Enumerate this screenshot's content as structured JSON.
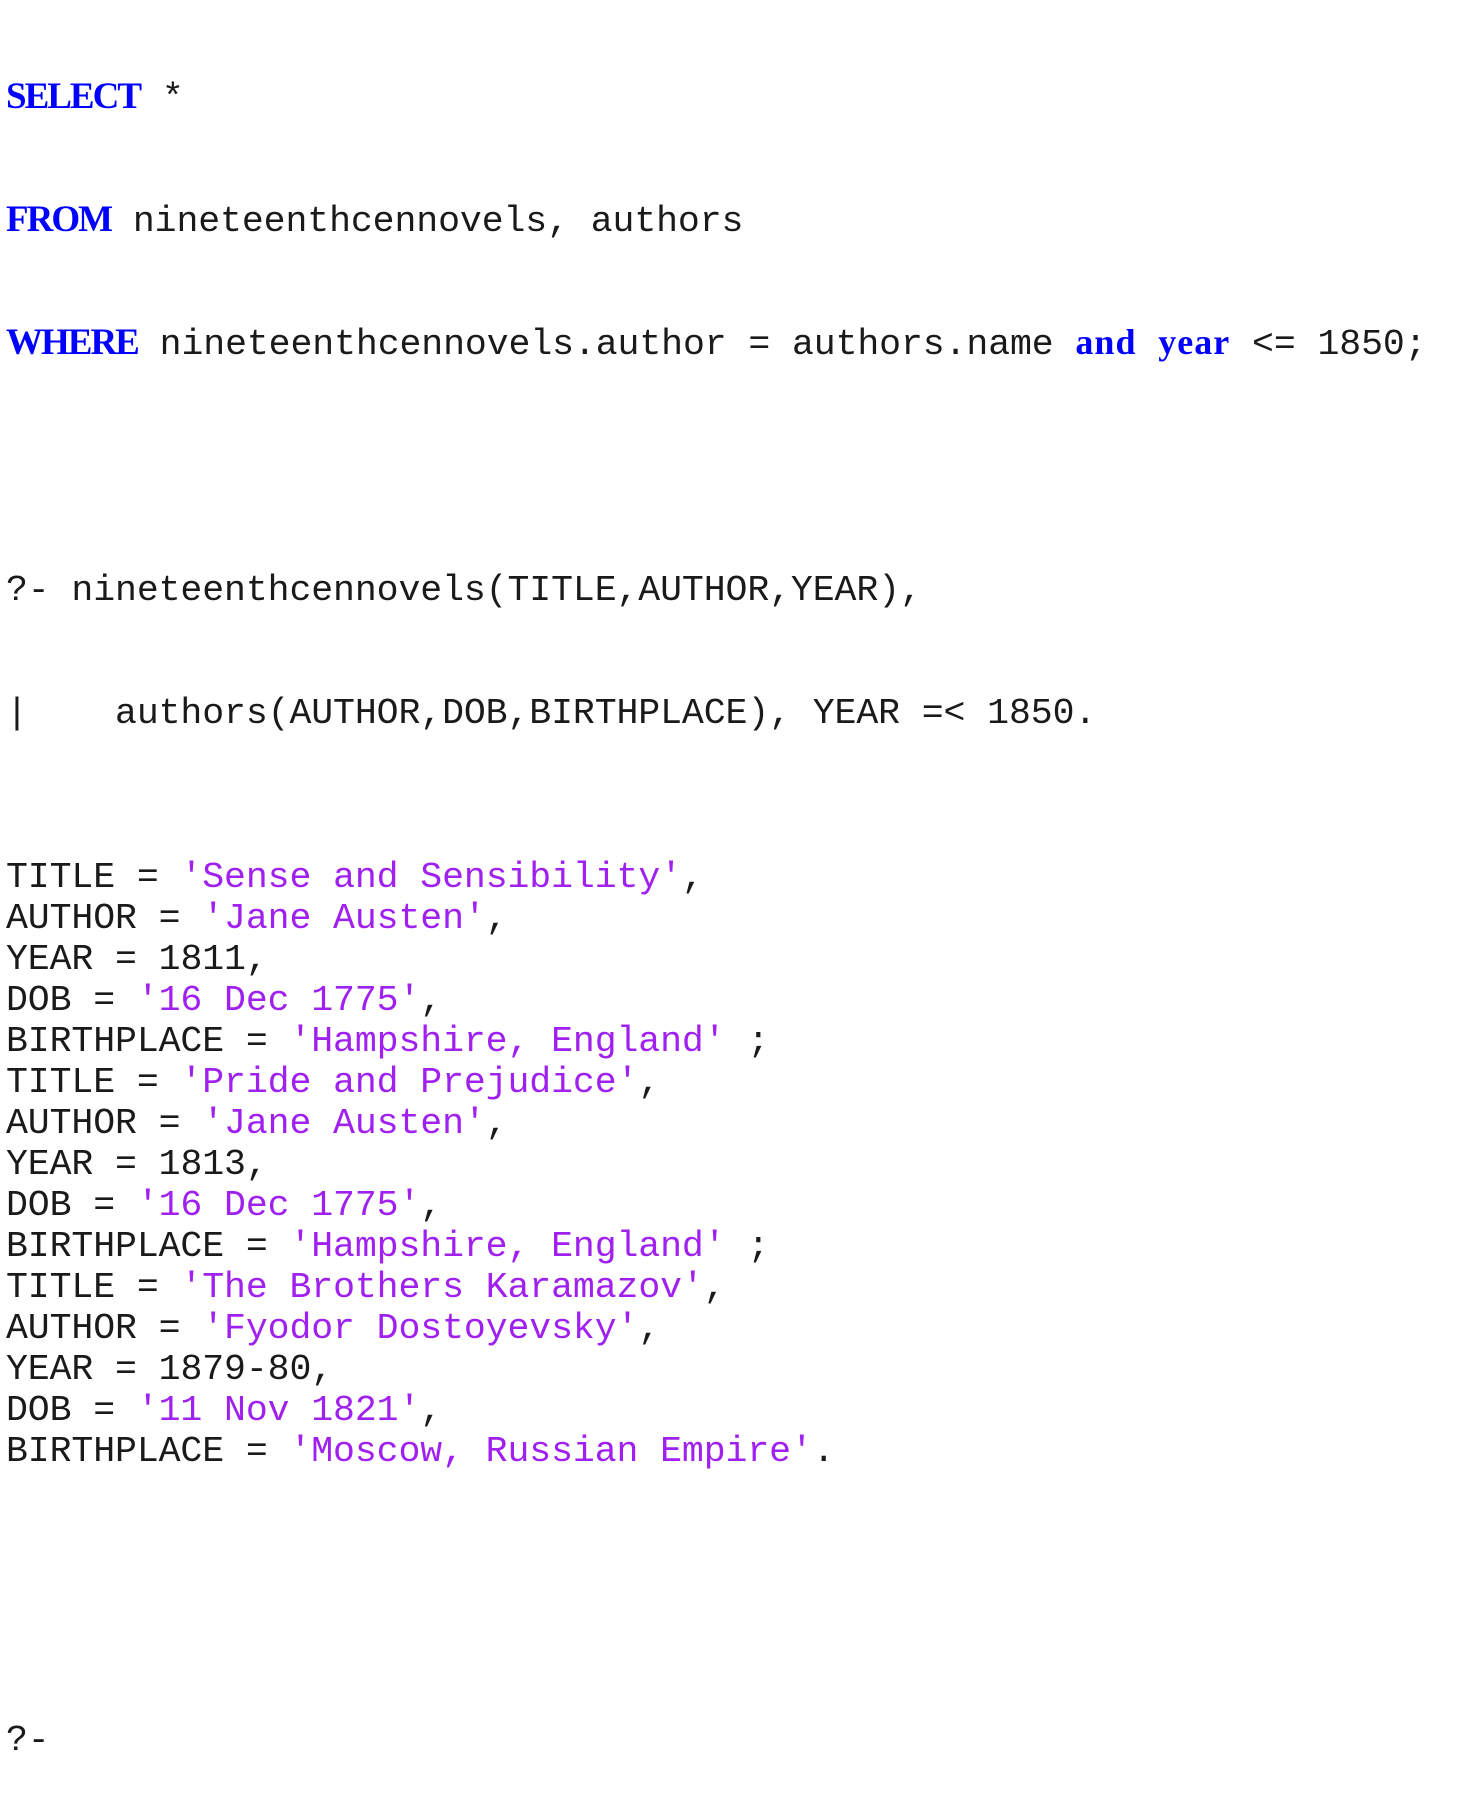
{
  "sql": {
    "select_kw": "SELECT",
    "select_rest": " *",
    "from_kw": "FROM",
    "from_rest": " nineteenthcennovels, authors",
    "where_kw": "WHERE",
    "where_rest": " nineteenthcennovels.author = authors.name ",
    "and_kw": "and",
    "year_kw": "year",
    "where_tail": " <= 1850;"
  },
  "prolog": {
    "query_line1": "?- nineteenthcennovels(TITLE,AUTHOR,YEAR),",
    "query_line2": "|    authors(AUTHOR,DOB,BIRTHPLACE), YEAR =< 1850.",
    "results": [
      {
        "title": "'Sense and Sensibility'",
        "author": "'Jane Austen'",
        "year": "1811",
        "dob": "'16 Dec 1775'",
        "birthplace": "'Hampshire, England'",
        "terminator": " ;"
      },
      {
        "title": "'Pride and Prejudice'",
        "author": "'Jane Austen'",
        "year": "1813",
        "dob": "'16 Dec 1775'",
        "birthplace": "'Hampshire, England'",
        "terminator": " ;"
      },
      {
        "title": "'The Brothers Karamazov'",
        "author": "'Fyodor Dostoyevsky'",
        "year": "1879-80",
        "dob": "'11 Nov 1821'",
        "birthplace": "'Moscow, Russian Empire'",
        "terminator": "."
      }
    ],
    "labels": {
      "title": "TITLE = ",
      "author": "AUTHOR = ",
      "year": "YEAR = ",
      "dob": "DOB = ",
      "birthplace": "BIRTHPLACE = ",
      "comma": ","
    },
    "prompt": "?-"
  },
  "colors": {
    "keyword": "#0000ff",
    "string": "#a020f0",
    "text": "#1a1a1a"
  }
}
